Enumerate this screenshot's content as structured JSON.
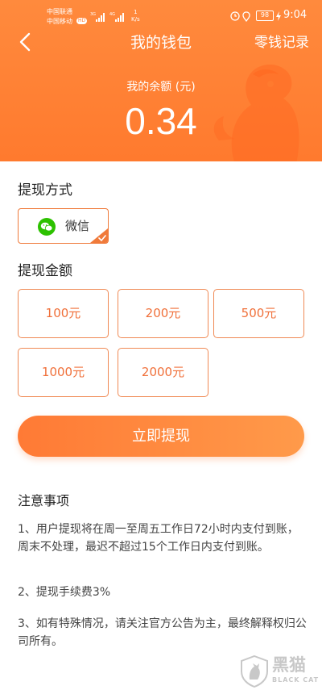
{
  "status_bar": {
    "carrier_1": "中国联通",
    "carrier_2": "中国移动",
    "hd_badge": "HD",
    "network_1": "3G",
    "network_2": "4G",
    "speed_value": "1",
    "speed_unit": "K/s",
    "battery": "98",
    "time": "9:04"
  },
  "nav": {
    "title": "我的钱包",
    "right_link": "零钱记录"
  },
  "balance": {
    "label": "我的余额 (元)",
    "value": "0.34"
  },
  "withdraw_method": {
    "section_title": "提现方式",
    "option_label": "微信",
    "icon": "wechat-icon",
    "selected": true
  },
  "withdraw_amount": {
    "section_title": "提现金额",
    "options": [
      "100元",
      "200元",
      "500元",
      "1000元",
      "2000元"
    ]
  },
  "submit_label": "立即提现",
  "notes": {
    "title": "注意事项",
    "items": [
      "1、用户提现将在周一至周五工作日72小时内支付到账，周末不处理，最迟不超过15个工作日内支付到账。",
      "2、提现手续费3%",
      "3、如有特殊情况，请关注官方公告为主，最终解释权归公司所有。"
    ]
  },
  "watermark": {
    "cn": "黑猫",
    "en": "BLACK CAT"
  },
  "colors": {
    "brand_orange": "#ff7a2e",
    "accent_border": "#f07a3a",
    "wechat_green": "#2dc100"
  }
}
